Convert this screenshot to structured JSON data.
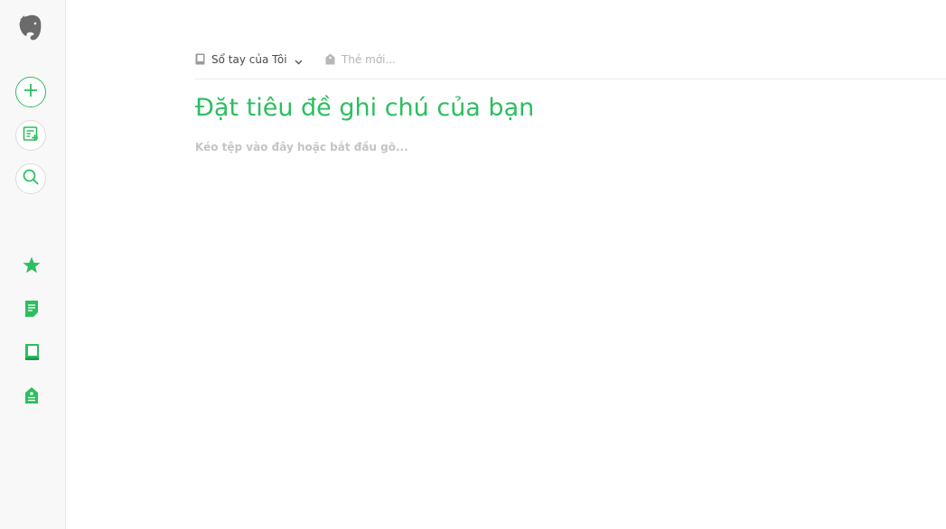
{
  "sidebar": {
    "logo": "elephant-logo",
    "buttons": [
      {
        "name": "new-note-button",
        "icon": "plus-icon"
      },
      {
        "name": "work-chat-button",
        "icon": "note-add-icon"
      },
      {
        "name": "search-button",
        "icon": "search-icon"
      }
    ],
    "nav": [
      {
        "name": "shortcuts",
        "icon": "star-icon"
      },
      {
        "name": "notes",
        "icon": "note-icon"
      },
      {
        "name": "notebooks",
        "icon": "notebook-icon"
      },
      {
        "name": "tags",
        "icon": "tag-icon"
      }
    ]
  },
  "editor": {
    "notebook_label": "Sổ tay của Tôi",
    "tag_placeholder": "Thẻ mới...",
    "title_placeholder": "Đặt tiêu đề ghi chú của bạn",
    "body_placeholder": "Kéo tệp vào đây hoặc bắt đầu gõ..."
  },
  "colors": {
    "accent": "#2dbe60",
    "sidebar_bg": "#f8f8f8",
    "logo": "#6b6b6b"
  }
}
